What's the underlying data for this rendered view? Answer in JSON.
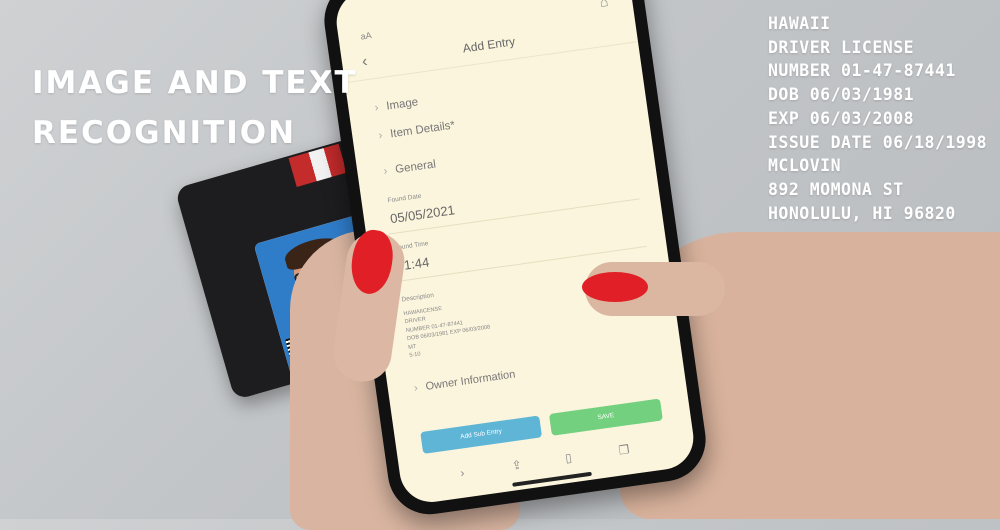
{
  "headline": {
    "line1": "IMAGE AND TEXT",
    "line2": "RECOGNITION"
  },
  "overlay_text": [
    "HAWAII",
    "DRIVER LICENSE",
    "NUMBER 01-47-87441",
    "DOB 06/03/1981",
    "EXP 06/03/2008",
    "ISSUE DATE 06/18/1998",
    "MCLOVIN",
    "892 MOMONA ST",
    "HONOLULU, HI 96820"
  ],
  "phone": {
    "status_text": "aA",
    "title": "Add Entry",
    "sections": {
      "image": "Image",
      "item_details": "Item Details*",
      "general": "General",
      "owner_information": "Owner Information"
    },
    "found_date": {
      "label": "Found Date",
      "value": "05/05/2021"
    },
    "found_time": {
      "label": "Found Time",
      "value": "01:44"
    },
    "description": {
      "label": "Description",
      "lines": [
        "HAWAIICENSE",
        "DRIVER",
        "NUMBER 01-47-87441",
        "DOB 06/03/1981 EXP 06/03/2008",
        "MT",
        "5-10"
      ]
    },
    "buttons": {
      "add_sub_entry": "Add Sub Entry",
      "save": "SAVE"
    }
  },
  "colors": {
    "screen_bg": "#fbf5dd",
    "add_sub_entry_btn": "#5fb5d6",
    "save_btn": "#73d07e",
    "nail_polish": "#e01f26"
  },
  "icons": [
    "back-arrow-icon",
    "home-icon",
    "chevron-right-icon",
    "share-icon",
    "book-icon",
    "tabs-icon"
  ]
}
